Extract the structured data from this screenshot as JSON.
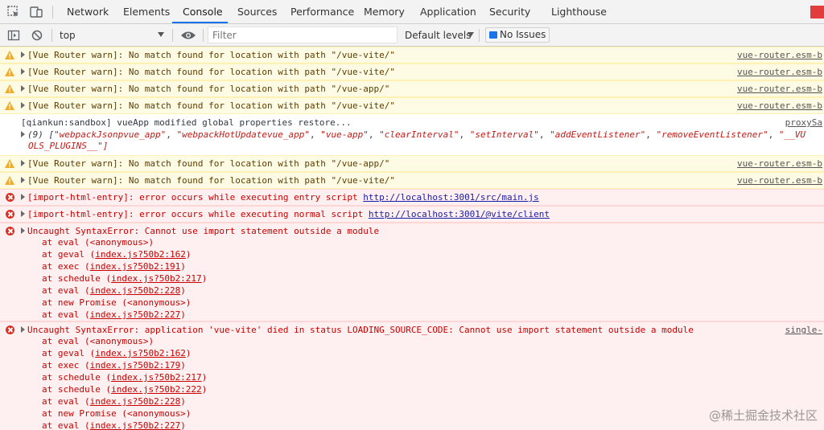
{
  "tabs": [
    "Network",
    "Elements",
    "Console",
    "Sources",
    "Performance",
    "Memory",
    "Application",
    "Security",
    "Lighthouse"
  ],
  "active_tab": "Console",
  "toolbar": {
    "context": "top",
    "filter_placeholder": "Filter",
    "levels_label": "Default levels",
    "issues_label": "No Issues"
  },
  "messages": {
    "w1": {
      "text": "[Vue Router warn]: No match found for location with path \"/vue-vite/\"",
      "source": "vue-router.esm-b"
    },
    "w2": {
      "text": "[Vue Router warn]: No match found for location with path \"/vue-vite/\"",
      "source": "vue-router.esm-b"
    },
    "w3": {
      "text": "[Vue Router warn]: No match found for location with path \"/vue-app/\"",
      "source": "vue-router.esm-b"
    },
    "w4": {
      "text": "[Vue Router warn]: No match found for location with path \"/vue-vite/\"",
      "source": "vue-router.esm-b"
    },
    "info": {
      "text": "[qiankun:sandbox] vueApp modified global properties restore...",
      "source": "proxySa",
      "array_count": "(9)",
      "items": [
        "\"webpackJsonpvue_app\"",
        "\"webpackHotUpdatevue_app\"",
        "\"vue-app\"",
        "\"clearInterval\"",
        "\"setInterval\"",
        "\"addEventListener\"",
        "\"removeEventListener\"",
        "\"__VU"
      ],
      "wrap": "OLS_PLUGINS__\"]"
    },
    "w5": {
      "text": "[Vue Router warn]: No match found for location with path \"/vue-app/\"",
      "source": "vue-router.esm-b"
    },
    "w6": {
      "text": "[Vue Router warn]: No match found for location with path \"/vue-vite/\"",
      "source": "vue-router.esm-b"
    },
    "e1": {
      "text": "[import-html-entry]: error occurs while executing entry script ",
      "link": "http://localhost:3001/src/main.js"
    },
    "e2": {
      "text": "[import-html-entry]: error occurs while executing normal script ",
      "link": "http://localhost:3001/@vite/client"
    },
    "e3": {
      "text": "Uncaught SyntaxError: Cannot use import statement outside a module",
      "stack": [
        {
          "fn": "at eval (<anonymous>)",
          "loc": ""
        },
        {
          "fn": "at geval (",
          "loc": "index.js?50b2:162"
        },
        {
          "fn": "at exec (",
          "loc": "index.js?50b2:191"
        },
        {
          "fn": "at schedule (",
          "loc": "index.js?50b2:217"
        },
        {
          "fn": "at eval (",
          "loc": "index.js?50b2:228"
        },
        {
          "fn": "at new Promise (<anonymous>)",
          "loc": ""
        },
        {
          "fn": "at eval (",
          "loc": "index.js?50b2:227"
        }
      ]
    },
    "e4": {
      "text": "Uncaught SyntaxError: application 'vue-vite' died in status LOADING_SOURCE_CODE: Cannot use import statement outside a module",
      "source": "single-",
      "stack": [
        {
          "fn": "at eval (<anonymous>)",
          "loc": ""
        },
        {
          "fn": "at geval (",
          "loc": "index.js?50b2:162"
        },
        {
          "fn": "at exec (",
          "loc": "index.js?50b2:179"
        },
        {
          "fn": "at schedule (",
          "loc": "index.js?50b2:217"
        },
        {
          "fn": "at schedule (",
          "loc": "index.js?50b2:222"
        },
        {
          "fn": "at eval (",
          "loc": "index.js?50b2:228"
        },
        {
          "fn": "at new Promise (<anonymous>)",
          "loc": ""
        },
        {
          "fn": "at eval (",
          "loc": "index.js?50b2:227"
        }
      ]
    }
  },
  "watermark": "@稀土掘金技术社区",
  "colors": {
    "accent": "#1a73e8",
    "error_text": "#c80000",
    "warn_text": "#5c3c00",
    "warn_bg": "#fefbe4",
    "error_bg": "#fef0f0"
  }
}
